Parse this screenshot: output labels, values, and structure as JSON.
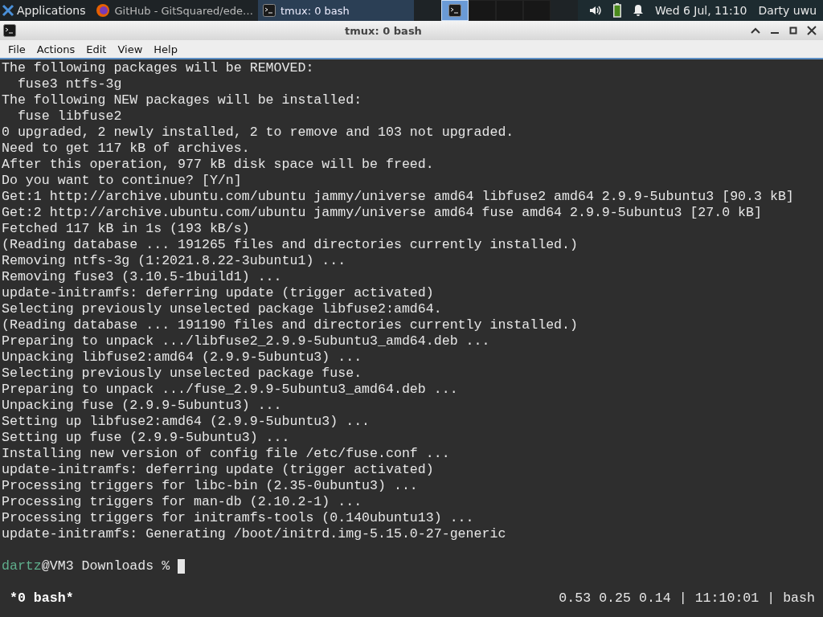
{
  "panel": {
    "apps_menu": "Applications",
    "tasks": [
      {
        "label": "GitHub - GitSquared/ede…",
        "kind": "browser",
        "selected": false
      },
      {
        "label": "tmux: 0 bash",
        "kind": "terminal",
        "selected": true
      }
    ],
    "workspaces": [
      {
        "selected": true
      },
      {
        "selected": false
      },
      {
        "selected": false
      },
      {
        "selected": false
      }
    ],
    "clock": "Wed  6 Jul, 11:10",
    "user": "Darty uwu"
  },
  "window": {
    "title": "tmux: 0 bash"
  },
  "menu": [
    "File",
    "Actions",
    "Edit",
    "View",
    "Help"
  ],
  "terminal": {
    "lines": [
      "The following packages will be REMOVED:",
      "  fuse3 ntfs-3g",
      "The following NEW packages will be installed:",
      "  fuse libfuse2",
      "0 upgraded, 2 newly installed, 2 to remove and 103 not upgraded.",
      "Need to get 117 kB of archives.",
      "After this operation, 977 kB disk space will be freed.",
      "Do you want to continue? [Y/n]",
      "Get:1 http://archive.ubuntu.com/ubuntu jammy/universe amd64 libfuse2 amd64 2.9.9-5ubuntu3 [90.3 kB]",
      "Get:2 http://archive.ubuntu.com/ubuntu jammy/universe amd64 fuse amd64 2.9.9-5ubuntu3 [27.0 kB]",
      "Fetched 117 kB in 1s (193 kB/s)",
      "(Reading database ... 191265 files and directories currently installed.)",
      "Removing ntfs-3g (1:2021.8.22-3ubuntu1) ...",
      "Removing fuse3 (3.10.5-1build1) ...",
      "update-initramfs: deferring update (trigger activated)",
      "Selecting previously unselected package libfuse2:amd64.",
      "(Reading database ... 191190 files and directories currently installed.)",
      "Preparing to unpack .../libfuse2_2.9.9-5ubuntu3_amd64.deb ...",
      "Unpacking libfuse2:amd64 (2.9.9-5ubuntu3) ...",
      "Selecting previously unselected package fuse.",
      "Preparing to unpack .../fuse_2.9.9-5ubuntu3_amd64.deb ...",
      "Unpacking fuse (2.9.9-5ubuntu3) ...",
      "Setting up libfuse2:amd64 (2.9.9-5ubuntu3) ...",
      "Setting up fuse (2.9.9-5ubuntu3) ...",
      "Installing new version of config file /etc/fuse.conf ...",
      "update-initramfs: deferring update (trigger activated)",
      "Processing triggers for libc-bin (2.35-0ubuntu3) ...",
      "Processing triggers for man-db (2.10.2-1) ...",
      "Processing triggers for initramfs-tools (0.140ubuntu13) ...",
      "update-initramfs: Generating /boot/initrd.img-5.15.0-27-generic"
    ],
    "prompt": {
      "user": "dartz",
      "rest": "@VM3 Downloads %"
    },
    "status_left": "*0 bash*",
    "status_right": "0.53 0.25 0.14 | 11:10:01 | bash"
  }
}
